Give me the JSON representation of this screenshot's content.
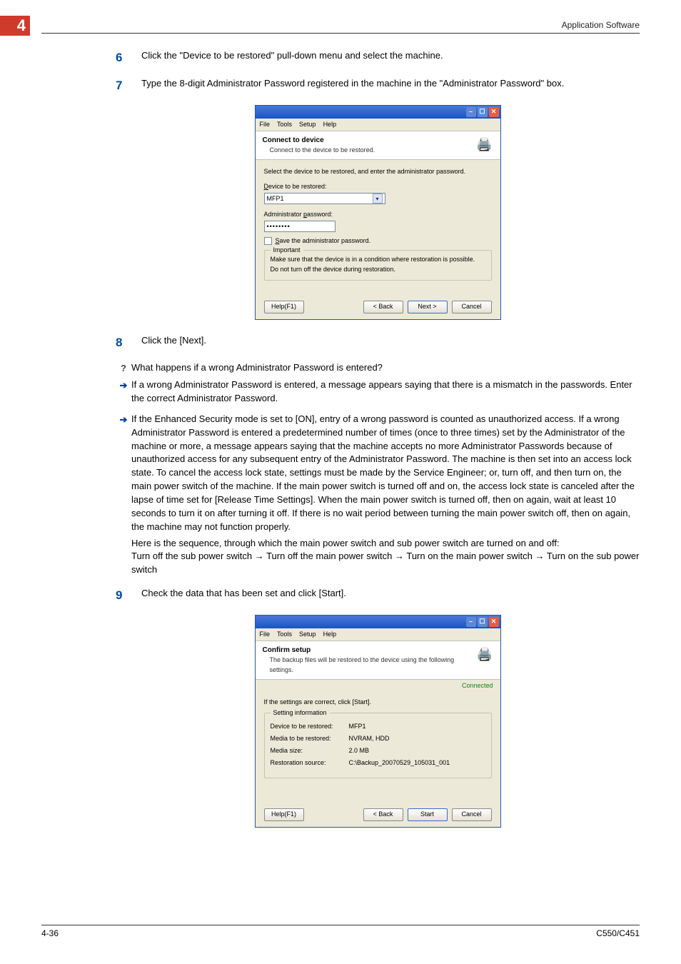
{
  "header": {
    "section_number": "4",
    "title": "Application Software"
  },
  "steps": {
    "s6": {
      "num": "6",
      "text": "Click the \"Device to be restored\" pull-down menu and select the machine."
    },
    "s7": {
      "num": "7",
      "text": "Type the 8-digit Administrator Password registered in the machine in the \"Administrator Password\" box."
    },
    "s8": {
      "num": "8",
      "text": "Click the [Next]."
    },
    "s9": {
      "num": "9",
      "text": "Check the data that has been set and click [Start]."
    }
  },
  "notes": {
    "q1": "What happens if a wrong Administrator Password is entered?",
    "a1": "If a wrong Administrator Password is entered, a message appears saying that there is a mismatch in the passwords. Enter the correct Administrator Password.",
    "a2": "If the Enhanced Security mode is set to [ON], entry of a wrong password is counted as unauthorized access. If a wrong Administrator Password is entered a predetermined number of times (once to three times) set by the Administrator of the machine or more, a message appears saying that the machine accepts no more Administrator Passwords because of unauthorized access for any subsequent entry of the Administrator Password. The machine is then set into an access lock state. To cancel the access lock state, settings must be made by the Service Engineer; or, turn off, and then turn on, the main power switch of the machine. If the main power switch is turned off and on, the access lock state is canceled after the lapse of time set for [Release Time Settings]. When the main power switch is turned off, then on again, wait at least 10 seconds to turn it on after turning it off. If there is no wait period between turning the main power switch off, then on again, the machine may not function properly.",
    "a2b": "Here is the sequence, through which the main power switch and sub power switch are turned on and off:",
    "a2c": "Turn off the sub power switch → Turn off the main power switch → Turn on the main power switch → Turn on the sub power switch"
  },
  "dialog1": {
    "menu": {
      "file": "File",
      "tools": "Tools",
      "setup": "Setup",
      "help": "Help"
    },
    "title": "Connect to device",
    "subtitle": "Connect to the device to be restored.",
    "intro": "Select the device to be restored, and enter the administrator password.",
    "device_label": "Device to be restored:",
    "device_value": "MFP1",
    "pw_label": "Administrator password:",
    "pw_value": "••••••••",
    "save_pw": "Save the administrator password.",
    "important_legend": "Important",
    "important_line1": "Make sure that the device is in a condition where restoration is possible.",
    "important_line2": "Do not turn off the device during restoration.",
    "btn_help": "Help(F1)",
    "btn_back": "< Back",
    "btn_next": "Next >",
    "btn_cancel": "Cancel"
  },
  "dialog2": {
    "menu": {
      "file": "File",
      "tools": "Tools",
      "setup": "Setup",
      "help": "Help"
    },
    "title": "Confirm setup",
    "subtitle": "The backup files will be restored to the device using the following settings.",
    "connected": "Connected",
    "intro": "If the settings are correct, click [Start].",
    "group_legend": "Setting information",
    "rows": {
      "r1k": "Device to be restored:",
      "r1v": "MFP1",
      "r2k": "Media to be restored:",
      "r2v": "NVRAM, HDD",
      "r3k": "Media size:",
      "r3v": "2.0 MB",
      "r4k": "Restoration source:",
      "r4v": "C:\\Backup_20070529_105031_001"
    },
    "btn_help": "Help(F1)",
    "btn_back": "< Back",
    "btn_start": "Start",
    "btn_cancel": "Cancel"
  },
  "footer": {
    "left": "4-36",
    "right": "C550/C451"
  }
}
